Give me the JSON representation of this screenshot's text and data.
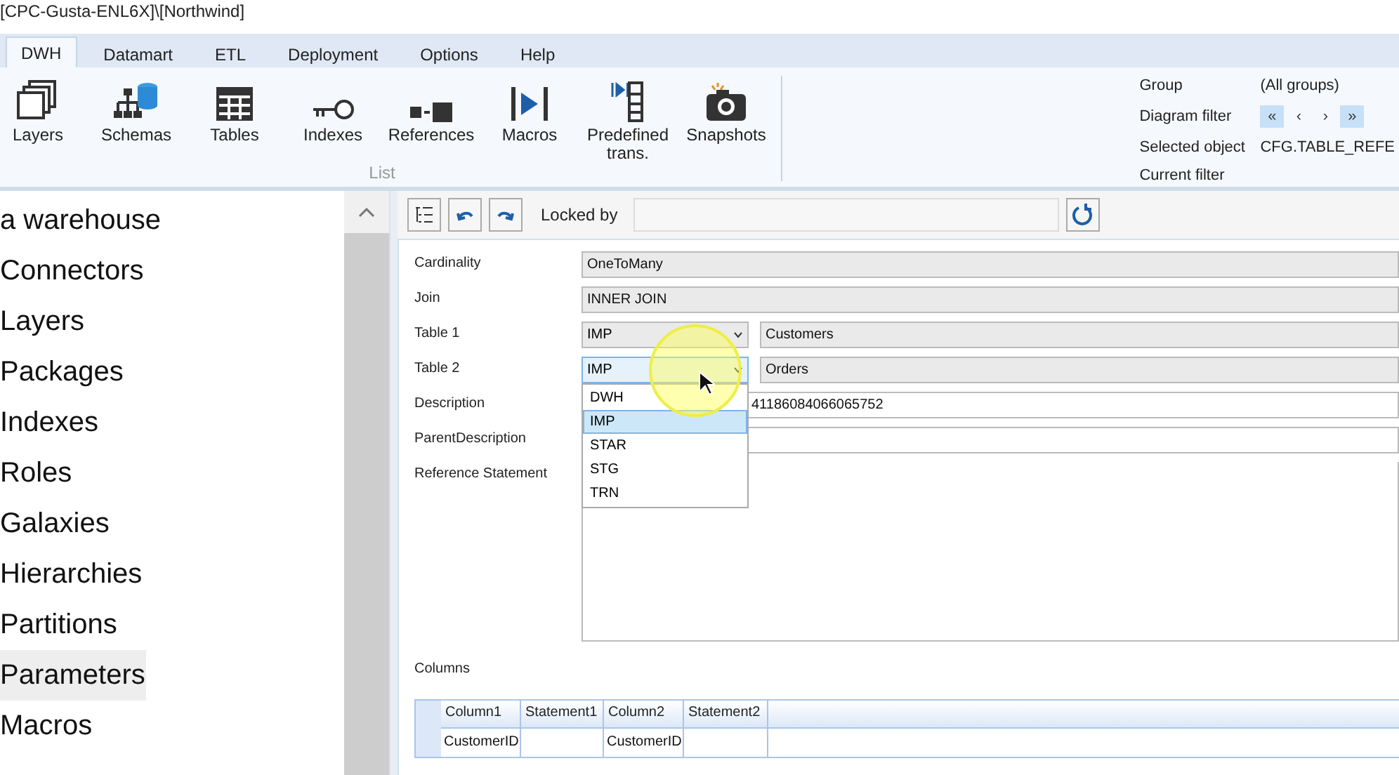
{
  "window": {
    "title": "[CPC-Gusta-ENL6X]\\[Northwind]"
  },
  "tabs": [
    {
      "label": "DWH",
      "selected": true
    },
    {
      "label": "Datamart",
      "selected": false
    },
    {
      "label": "ETL",
      "selected": false
    },
    {
      "label": "Deployment",
      "selected": false
    },
    {
      "label": "Options",
      "selected": false
    },
    {
      "label": "Help",
      "selected": false
    }
  ],
  "ribbon": {
    "group_label": "List",
    "buttons": [
      {
        "label": "Layers"
      },
      {
        "label": "Schemas"
      },
      {
        "label": "Tables"
      },
      {
        "label": "Indexes"
      },
      {
        "label": "References"
      },
      {
        "label": "Macros"
      },
      {
        "label": "Predefined trans."
      },
      {
        "label": "Snapshots"
      }
    ],
    "filters": {
      "group_label": "Group",
      "group_value": "(All groups)",
      "diagram_label": "Diagram filter",
      "nav": [
        {
          "label": "«",
          "selected": true
        },
        {
          "label": "‹",
          "selected": false
        },
        {
          "label": "›",
          "selected": false
        },
        {
          "label": "»",
          "selected": true
        }
      ],
      "selected_label": "Selected object",
      "selected_value": "CFG.TABLE_REFE",
      "current_label": "Current filter"
    }
  },
  "sidebar": {
    "items": [
      {
        "label": "a warehouse",
        "selected": false
      },
      {
        "label": "Connectors",
        "selected": false
      },
      {
        "label": "Layers",
        "selected": false
      },
      {
        "label": "Packages",
        "selected": false
      },
      {
        "label": "Indexes",
        "selected": false
      },
      {
        "label": "Roles",
        "selected": false
      },
      {
        "label": "Galaxies",
        "selected": false
      },
      {
        "label": "Hierarchies",
        "selected": false
      },
      {
        "label": "Partitions",
        "selected": false
      },
      {
        "label": "Parameters",
        "selected": true
      },
      {
        "label": "Macros",
        "selected": false
      }
    ]
  },
  "editor": {
    "locked_by_label": "Locked by",
    "fields": [
      {
        "kind": "text",
        "label": "Cardinality",
        "value": "OneToMany"
      },
      {
        "kind": "text",
        "label": "Join",
        "value": "INNER JOIN"
      },
      {
        "kind": "table",
        "label": "Table 1",
        "layer": "IMP",
        "table": "Customers",
        "expanded": false
      },
      {
        "kind": "table",
        "label": "Table 2",
        "layer": "IMP",
        "table": "Orders",
        "expanded": true,
        "options": [
          {
            "label": "DWH",
            "selected": false
          },
          {
            "label": "IMP",
            "selected": true
          },
          {
            "label": "STAR",
            "selected": false
          },
          {
            "label": "STG",
            "selected": false
          },
          {
            "label": "TRN",
            "selected": false
          }
        ]
      },
      {
        "kind": "white",
        "label": "Description",
        "value": "41186084066065752"
      },
      {
        "kind": "white",
        "label": "ParentDescription"
      },
      {
        "kind": "area",
        "label": "Reference Statement"
      }
    ],
    "columns_label": "Columns",
    "grid": {
      "columns": [
        "Column1",
        "Statement1",
        "Column2",
        "Statement2"
      ],
      "rows": [
        [
          "CustomerID",
          "",
          "CustomerID",
          ""
        ]
      ]
    }
  }
}
